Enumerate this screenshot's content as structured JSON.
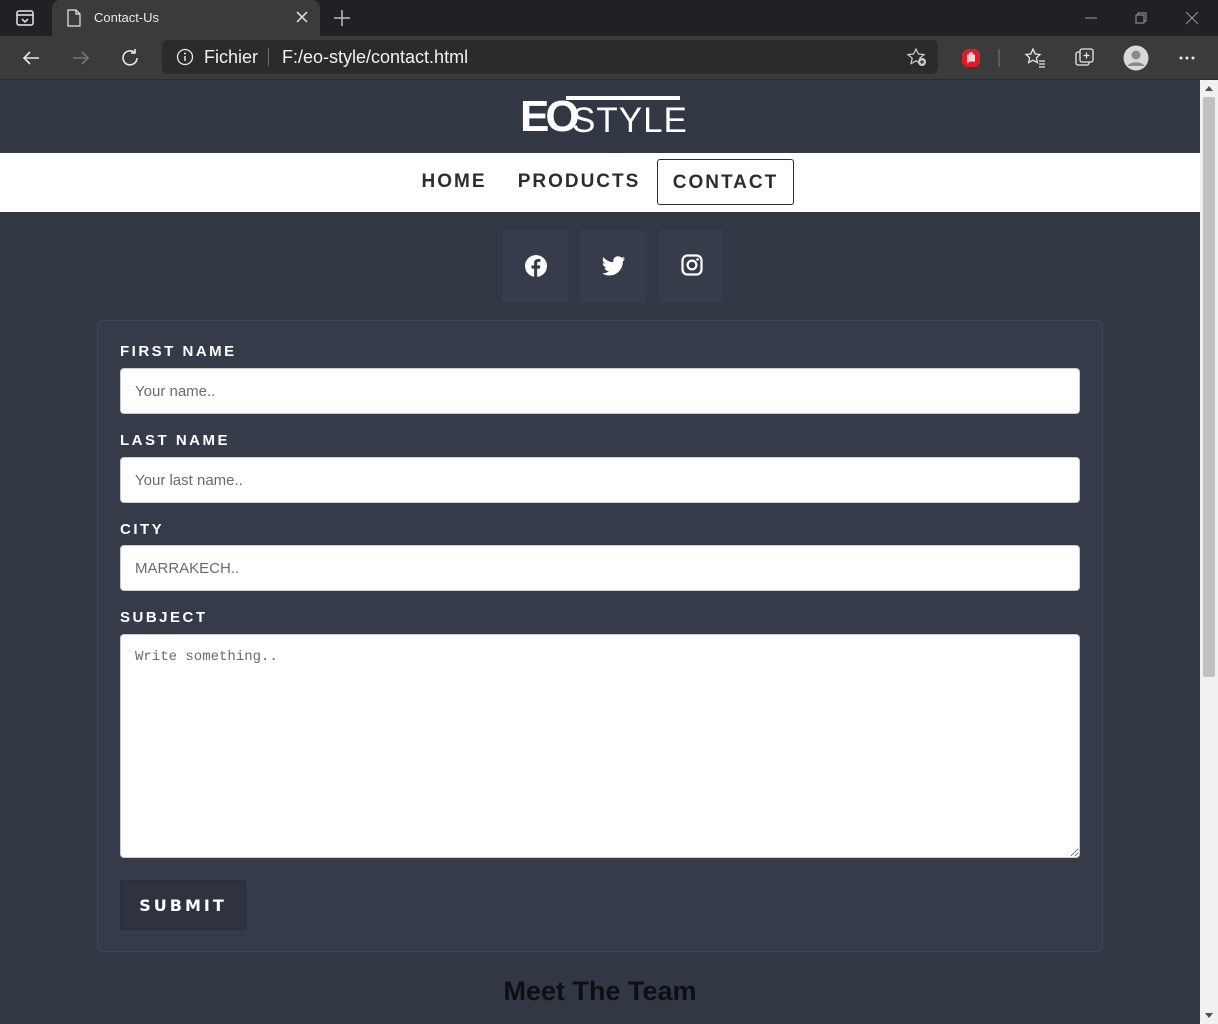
{
  "browser": {
    "tab_title": "Contact-Us",
    "address_scheme": "Fichier",
    "address_url": "F:/eo-style/contact.html"
  },
  "site": {
    "logo_eo": "EO",
    "logo_style": "STYLE",
    "nav": [
      {
        "label": "HOME",
        "active": false
      },
      {
        "label": "PRODUCTS",
        "active": false
      },
      {
        "label": "CONTACT",
        "active": true
      }
    ],
    "social_icons": [
      "facebook-icon",
      "twitter-icon",
      "instagram-icon"
    ]
  },
  "form": {
    "first_name_label": "FIRST NAME",
    "first_name_placeholder": "Your name..",
    "last_name_label": "LAST NAME",
    "last_name_placeholder": "Your last name..",
    "city_label": "CITY",
    "city_placeholder": "MARRAKECH..",
    "subject_label": "SUBJECT",
    "subject_placeholder": "Write something..",
    "submit_label": "SUBMIT"
  },
  "team_heading": "Meet The Team",
  "colors": {
    "page_bg": "#323744",
    "card_bg": "#363b4a",
    "nav_bg": "#ffffff",
    "social_bg": "#373c4a"
  }
}
